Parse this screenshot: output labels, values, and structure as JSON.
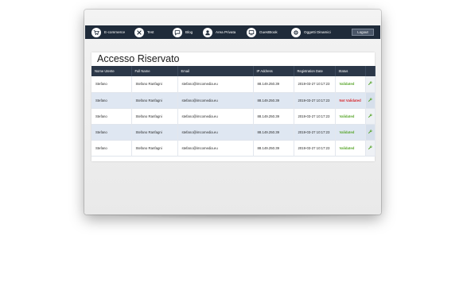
{
  "nav": {
    "items": [
      {
        "label": "E-commerce",
        "icon": "cart-icon"
      },
      {
        "label": "Test",
        "icon": "tools-icon"
      },
      {
        "label": "Blog",
        "icon": "chat-icon"
      },
      {
        "label": "Area Privata",
        "icon": "user-icon"
      },
      {
        "label": "GuestBook",
        "icon": "guestbook-icon"
      },
      {
        "label": "Oggetti Dinamici",
        "icon": "gear-icon"
      }
    ],
    "logout": "Logout"
  },
  "page": {
    "title": "Accesso Riservato"
  },
  "table": {
    "headers": [
      "Nome Utente",
      "Full Name",
      "Email",
      "IP Address",
      "Registration Date",
      "Status",
      ""
    ],
    "rows": [
      {
        "user": "Stefano",
        "full": "Stefano Ranfagni",
        "email": "stefano@imcomedia.eu",
        "ip": "88.149.250.39",
        "date": "2019-03-27 10:17:23",
        "status": "Validated"
      },
      {
        "user": "Stefano",
        "full": "Stefano Ranfagni",
        "email": "stefano@imcomedia.eu",
        "ip": "88.149.250.39",
        "date": "2019-03-27 10:17:23",
        "status": "Not Validated"
      },
      {
        "user": "Stefano",
        "full": "Stefano Ranfagni",
        "email": "stefano@imcomedia.eu",
        "ip": "88.149.250.39",
        "date": "2019-03-27 10:17:23",
        "status": "Validated"
      },
      {
        "user": "Stefano",
        "full": "Stefano Ranfagni",
        "email": "stefano@imcomedia.eu",
        "ip": "88.149.250.39",
        "date": "2019-03-27 10:17:23",
        "status": "Validated"
      },
      {
        "user": "Stefano",
        "full": "Stefano Ranfagni",
        "email": "stefano@imcomedia.eu",
        "ip": "88.149.250.39",
        "date": "2019-03-27 10:17:23",
        "status": "Validated"
      }
    ]
  },
  "colors": {
    "navbar": "#1f2b3a",
    "table_header": "#2b3748",
    "validated": "#58a52b",
    "not_validated": "#d6282d",
    "row_alt": "#dfe7f2"
  }
}
